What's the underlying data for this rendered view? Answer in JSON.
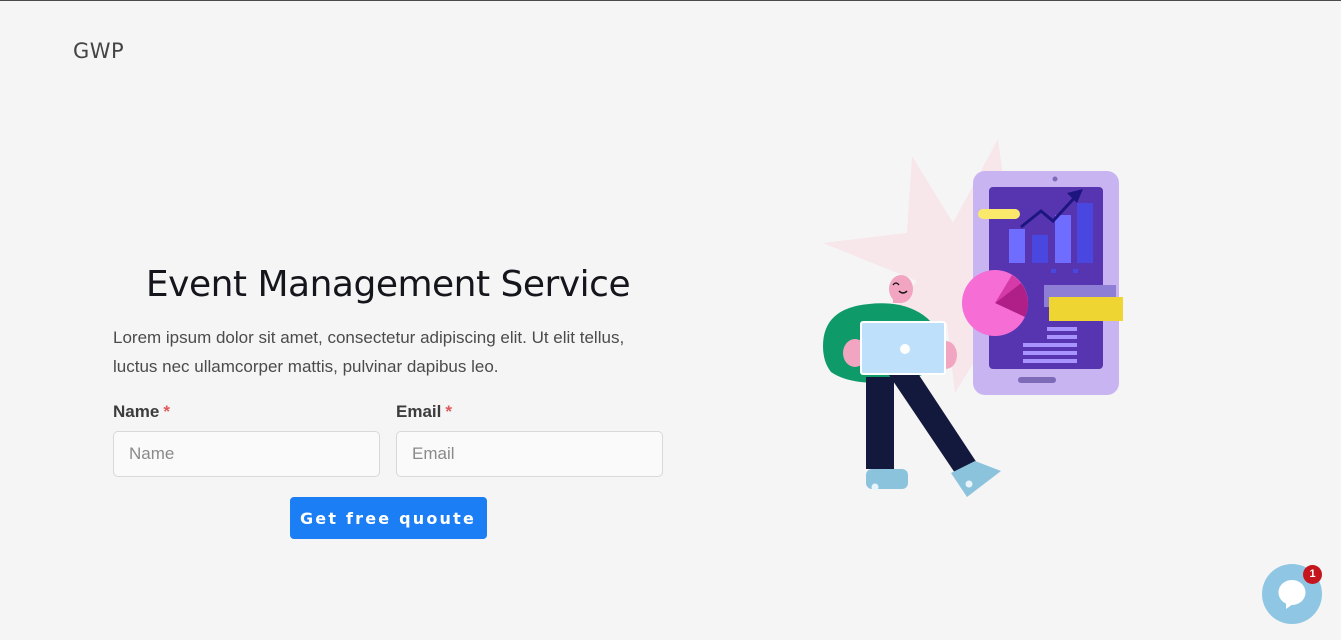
{
  "header": {
    "logo_text": "GWP"
  },
  "hero": {
    "title": "Event Management Service",
    "description": "Lorem ipsum dolor sit amet, consectetur adipiscing elit. Ut elit tellus, luctus nec ullamcorper mattis, pulvinar dapibus leo."
  },
  "form": {
    "name_label": "Name",
    "name_required_marker": "*",
    "name_placeholder": "Name",
    "email_label": "Email",
    "email_required_marker": "*",
    "email_placeholder": "Email",
    "submit_label": "Get free quoute"
  },
  "chat": {
    "icon": "chat-bubble-icon",
    "badge_count": "1"
  },
  "colors": {
    "page_background": "#f5f5f5",
    "accent_button": "#1c7ef4",
    "required_marker": "#e0595b",
    "chat_widget": "#8ec6e3",
    "chat_badge": "#c4161c"
  }
}
